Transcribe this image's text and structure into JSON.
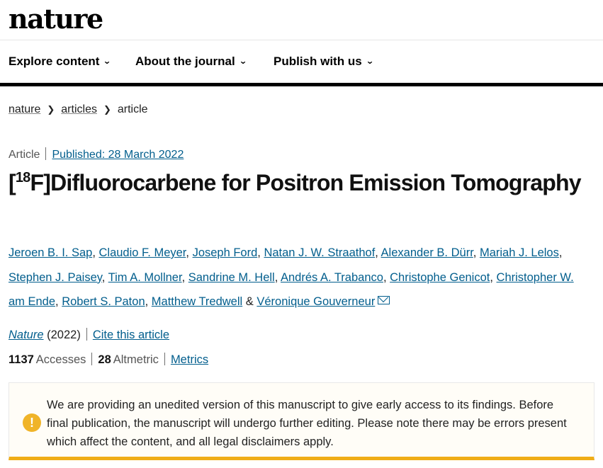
{
  "site": {
    "logo": "nature"
  },
  "nav": [
    {
      "label": "Explore content"
    },
    {
      "label": "About the journal"
    },
    {
      "label": "Publish with us"
    }
  ],
  "breadcrumb": {
    "items": [
      "nature",
      "articles",
      "article"
    ]
  },
  "article": {
    "type": "Article",
    "published": "Published: 28 March 2022",
    "title_bracket_open": "[",
    "title_superscript": "18",
    "title_rest": "F]Difluorocarbene for Positron Emission Tomography",
    "authors": [
      "Jeroen B. I. Sap",
      "Claudio F. Meyer",
      "Joseph Ford",
      "Natan J. W. Straathof",
      "Alexander B. Dürr",
      "Mariah J. Lelos",
      "Stephen J. Paisey",
      "Tim A. Mollner",
      "Sandrine M. Hell",
      "Andrés A. Trabanco",
      "Christophe Genicot",
      "Christopher W. am Ende",
      "Robert S. Paton",
      "Matthew Tredwell",
      "Véronique Gouverneur"
    ],
    "author_sep": ", ",
    "author_last_sep": " & ",
    "journal": "Nature",
    "year": " (2022)",
    "cite_label": "Cite this article",
    "accesses_value": "1137",
    "accesses_label": "Accesses",
    "altmetric_value": "28",
    "altmetric_label": "Altmetric",
    "metrics_label": "Metrics"
  },
  "notice": {
    "icon": "!",
    "text": "We are providing an unedited version of this manuscript to give early access to its findings. Before final publication, the manuscript will undergo further editing. Please note there may be errors present which affect the content, and all legal disclaimers apply."
  },
  "colors": {
    "link": "#025e8d",
    "notice_accent": "#f0ad17",
    "warning_icon": "#f0b429"
  }
}
